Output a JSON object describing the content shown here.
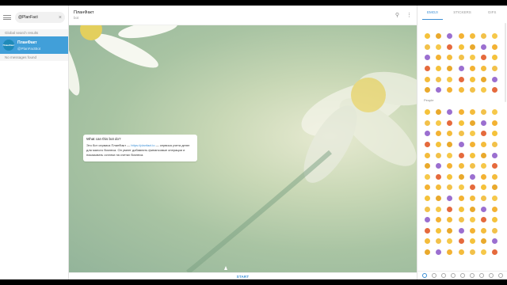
{
  "search": {
    "value": "@PlanFact"
  },
  "left": {
    "global_label": "Global search results",
    "result": {
      "name": "ПланФакт",
      "handle": "@PlanFactBot",
      "avatar_text": "ПланФакт"
    },
    "no_messages": "No messages found"
  },
  "chat": {
    "title": "ПланФакт",
    "subtitle": "bot",
    "card_heading": "What can this bot do?",
    "card_text_1": "Это бот сервиса ПланФакт — ",
    "card_link": "https://planfact.io",
    "card_text_2": " — сервиса учета денег для малого бизнеса. Он умеет добавлять финансовые операции и показывать остатки на счетах бизнеса.",
    "start_label": "START"
  },
  "emoji_panel": {
    "tabs": [
      "EMOJI",
      "STICKERS",
      "GIFS"
    ],
    "category_label": "People",
    "icons": [
      "recent-icon",
      "smile-icon",
      "animal-icon",
      "food-icon",
      "sport-icon",
      "car-icon",
      "object-icon",
      "symbol-icon",
      "flag-icon"
    ]
  },
  "colors": {
    "accent": "#3a8ed5",
    "selection": "#419fd9",
    "emoji_yellow": "#f5c23b"
  }
}
